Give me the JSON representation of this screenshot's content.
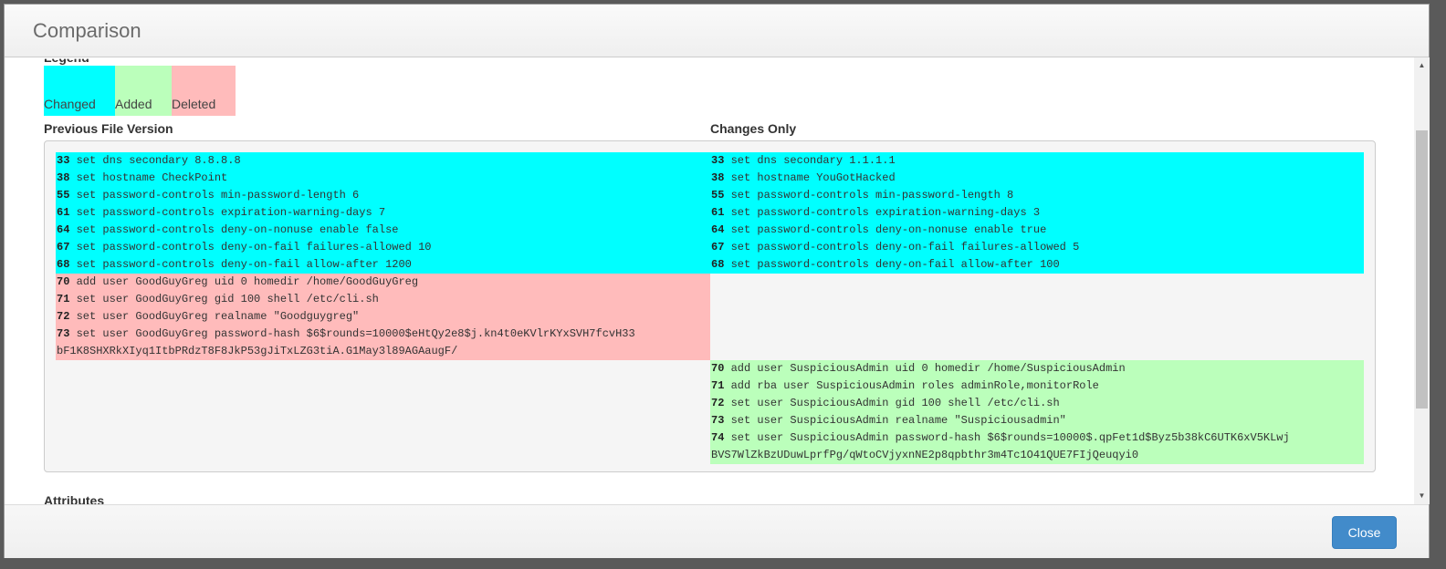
{
  "modal": {
    "title": "Comparison",
    "close_label": "Close"
  },
  "legend": {
    "heading": "Legend",
    "items": [
      {
        "label": "Changed",
        "color": "#00ffff"
      },
      {
        "label": "Added",
        "color": "#bbffbb"
      },
      {
        "label": "Deleted",
        "color": "#ffbbbb"
      }
    ]
  },
  "columns": {
    "left": "Previous File Version",
    "right": "Changes Only"
  },
  "changed": [
    {
      "n": "33",
      "old": "set dns secondary 8.8.8.8",
      "new": "set dns secondary 1.1.1.1"
    },
    {
      "n": "38",
      "old": "set hostname CheckPoint",
      "new": "set hostname YouGotHacked"
    },
    {
      "n": "55",
      "old": "set password-controls min-password-length 6",
      "new": "set password-controls min-password-length 8"
    },
    {
      "n": "61",
      "old": "set password-controls expiration-warning-days 7",
      "new": "set password-controls expiration-warning-days 3"
    },
    {
      "n": "64",
      "old": "set password-controls deny-on-nonuse enable false",
      "new": "set password-controls deny-on-nonuse enable true"
    },
    {
      "n": "67",
      "old": "set password-controls deny-on-fail failures-allowed 10",
      "new": "set password-controls deny-on-fail failures-allowed 5"
    },
    {
      "n": "68",
      "old": "set password-controls deny-on-fail allow-after 1200",
      "new": "set password-controls deny-on-fail allow-after 100"
    }
  ],
  "deleted": [
    {
      "n": "70",
      "text": "add user GoodGuyGreg uid 0 homedir /home/GoodGuyGreg"
    },
    {
      "n": "71",
      "text": "set user GoodGuyGreg gid 100 shell /etc/cli.sh"
    },
    {
      "n": "72",
      "text": "set user GoodGuyGreg realname \"Goodguygreg\""
    },
    {
      "n": "73",
      "text": "set user GoodGuyGreg password-hash $6$rounds=10000$eHtQy2e8$j.kn4t0eKVlrKYxSVH7fcvH33",
      "cont": "bF1K8SHXRkXIyq1ItbPRdzT8F8JkP53gJiTxLZG3tiA.G1May3l89AGAaugF/"
    }
  ],
  "added": [
    {
      "n": "70",
      "text": "add user SuspiciousAdmin uid 0 homedir /home/SuspiciousAdmin"
    },
    {
      "n": "71",
      "text": "add rba user SuspiciousAdmin roles adminRole,monitorRole"
    },
    {
      "n": "72",
      "text": "set user SuspiciousAdmin gid 100 shell /etc/cli.sh"
    },
    {
      "n": "73",
      "text": "set user SuspiciousAdmin realname \"Suspiciousadmin\""
    },
    {
      "n": "74",
      "text": "set user SuspiciousAdmin password-hash $6$rounds=10000$.qpFet1d$Byz5b38kC6UTK6xV5KLwj",
      "cont": "BVS7WlZkBzUDuwLprfPg/qWtoCVjyxnNE2p8qpbthr3m4Tc1O41QUE7FIjQeuqyi0"
    }
  ],
  "attributes_heading": "Attributes"
}
